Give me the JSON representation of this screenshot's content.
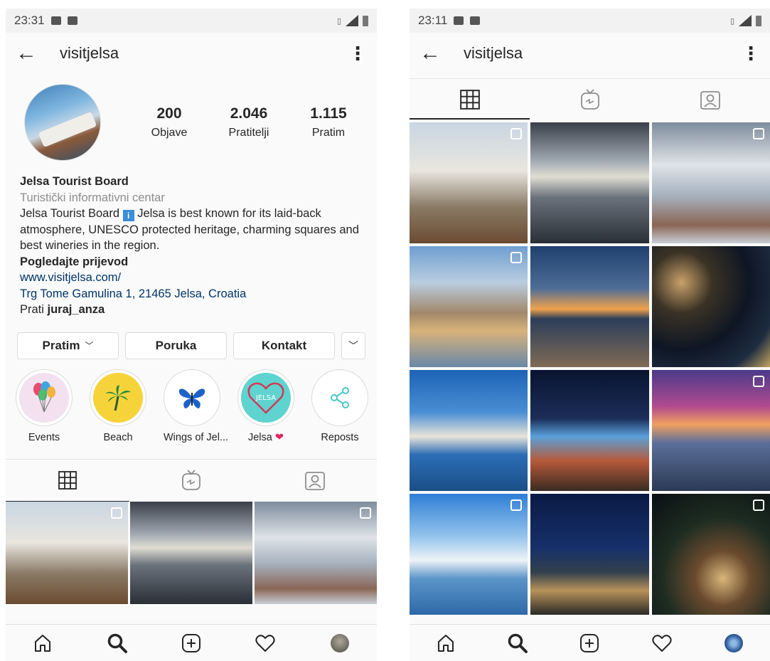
{
  "left": {
    "status": {
      "time": "23:31"
    },
    "username": "visitjelsa",
    "stats": [
      {
        "num": "200",
        "label": "Objave"
      },
      {
        "num": "2.046",
        "label": "Pratitelji"
      },
      {
        "num": "1.115",
        "label": "Pratim"
      }
    ],
    "bio": {
      "name": "Jelsa Tourist Board",
      "category": "Turistički informativni centar",
      "text_before": "Jelsa Tourist Board ",
      "badge": "i",
      "text_after": " Jelsa is best known for its laid-back atmosphere, UNESCO protected heritage, charming squares and best wineries in the region.",
      "translate": "Pogledajte prijevod",
      "website": "www.visitjelsa.com/",
      "address": "Trg Tome Gamulina 1, 21465 Jelsa, Croatia",
      "followed_by_prefix": "Prati ",
      "followed_by_user": "juraj_anza"
    },
    "buttons": {
      "following": "Pratim",
      "message": "Poruka",
      "contact": "Kontakt"
    },
    "highlights": [
      {
        "label": "Events",
        "bg": "#f3e1ef",
        "icon": "balloons-icon"
      },
      {
        "label": "Beach",
        "bg": "#f7d33a",
        "icon": "palm-tree-icon"
      },
      {
        "label": "Wings of Jel...",
        "bg": "#ffffff",
        "icon": "butterfly-icon"
      },
      {
        "label": "Jelsa",
        "bg": "#5fd3cf",
        "icon": "heart-jelsa-icon"
      },
      {
        "label": "Reposts",
        "bg": "#ffffff",
        "icon": "share-icon"
      }
    ],
    "heart_emoji": "❤"
  },
  "right": {
    "status": {
      "time": "23:11"
    },
    "username": "visitjelsa"
  },
  "colors": {
    "link": "#003569",
    "muted": "#8e8e8e",
    "text": "#262626",
    "border": "#dbdbdb"
  }
}
